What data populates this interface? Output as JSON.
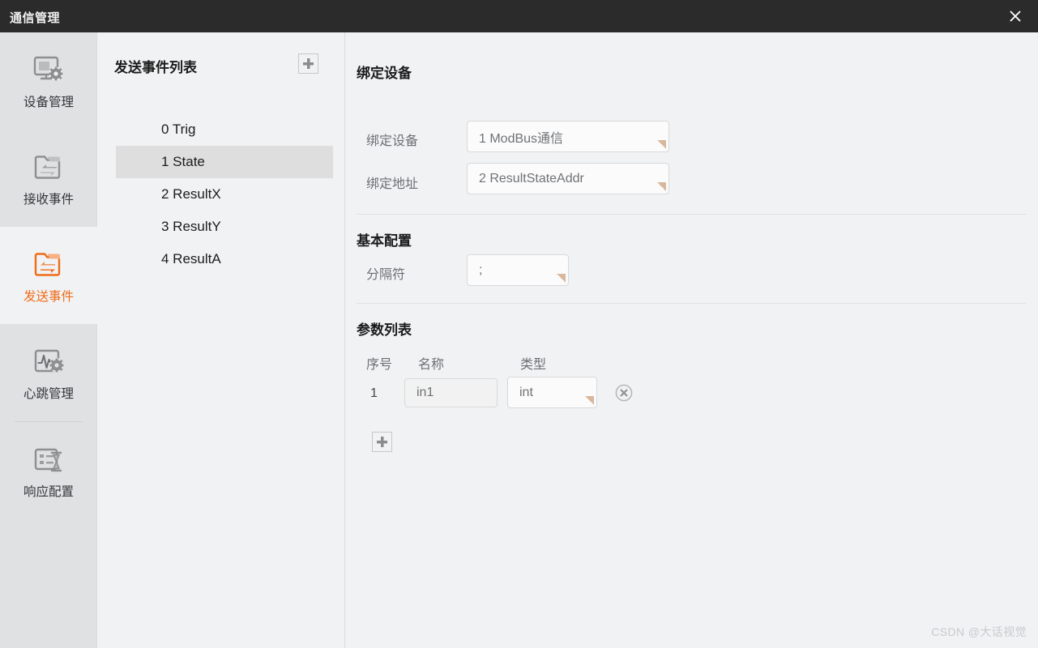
{
  "window": {
    "title": "通信管理",
    "close_icon": "close-icon"
  },
  "sidebar": {
    "items": [
      {
        "label": "设备管理",
        "icon": "monitor-gear-icon",
        "active": false
      },
      {
        "label": "接收事件",
        "icon": "folder-in-arrow-icon",
        "active": false
      },
      {
        "label": "发送事件",
        "icon": "folder-out-arrow-icon",
        "active": true
      },
      {
        "label": "心跳管理",
        "icon": "waveform-gear-icon",
        "active": false
      },
      {
        "label": "响应配置",
        "icon": "list-hourglass-icon",
        "active": false
      }
    ],
    "active_color": "#ef6c18"
  },
  "list_panel": {
    "title": "发送事件列表",
    "add_button_icon": "plus-icon",
    "items": [
      {
        "label": "0 Trig",
        "selected": false
      },
      {
        "label": "1 State",
        "selected": true
      },
      {
        "label": "2 ResultX",
        "selected": false
      },
      {
        "label": "3 ResultY",
        "selected": false
      },
      {
        "label": "4 ResultA",
        "selected": false
      }
    ]
  },
  "detail": {
    "bind_device_section": {
      "title": "绑定设备",
      "device_label": "绑定设备",
      "device_value": "1 ModBus通信",
      "address_label": "绑定地址",
      "address_value": "2 ResultStateAddr"
    },
    "basic_section": {
      "title": "基本配置",
      "separator_label": "分隔符",
      "separator_value": ";"
    },
    "param_section": {
      "title": "参数列表",
      "columns": [
        "序号",
        "名称",
        "类型"
      ],
      "rows": [
        {
          "no": "1",
          "name": "in1",
          "type": "int",
          "delete_icon": "circle-x-icon"
        }
      ],
      "add_button_icon": "plus-icon"
    }
  },
  "watermark": "CSDN @大话视觉"
}
